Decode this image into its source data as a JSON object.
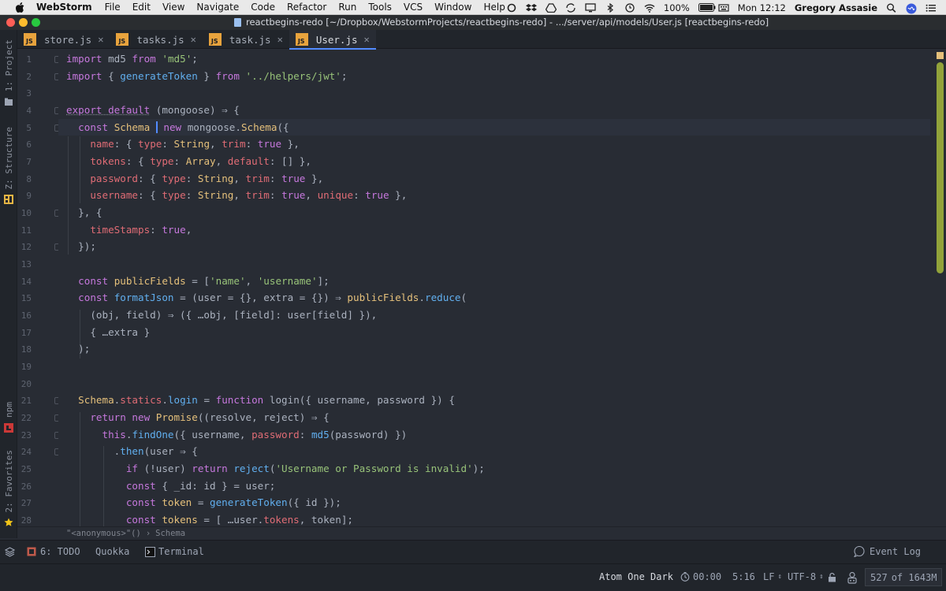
{
  "menubar": {
    "app_name": "WebStorm",
    "items": [
      "File",
      "Edit",
      "View",
      "Navigate",
      "Code",
      "Refactor",
      "Run",
      "Tools",
      "VCS",
      "Window",
      "Help"
    ],
    "battery": "100%",
    "clock": "Mon 12:12",
    "user": "Gregory Assasie"
  },
  "window": {
    "title": "reactbegins-redo [~/Dropbox/WebstormProjects/reactbegins-redo] - .../server/api/models/User.js [reactbegins-redo]"
  },
  "tabs": [
    {
      "label": "store.js",
      "active": false
    },
    {
      "label": "tasks.js",
      "active": false
    },
    {
      "label": "task.js",
      "active": false
    },
    {
      "label": "User.js",
      "active": true
    }
  ],
  "left_tools": {
    "project": "1: Project",
    "structure": "Z: Structure",
    "npm": "npm",
    "favorites": "2: Favorites"
  },
  "editor": {
    "line_numbers": [
      "1",
      "2",
      "3",
      "4",
      "5",
      "6",
      "7",
      "8",
      "9",
      "10",
      "11",
      "12",
      "13",
      "14",
      "15",
      "16",
      "17",
      "18",
      "19",
      "20",
      "21",
      "22",
      "23",
      "24",
      "25",
      "26",
      "27",
      "28"
    ],
    "current_line": "5"
  },
  "breadcrumb": {
    "scope": "\"<anonymous>\"()",
    "separator": "›",
    "symbol": "Schema"
  },
  "tool_windows": {
    "todo": "6: TODO",
    "quokka": "Quokka",
    "terminal": "Terminal",
    "event_log": "Event Log"
  },
  "status": {
    "theme": "Atom One Dark",
    "timer": "00:00",
    "position": "5:16",
    "line_sep": "LF",
    "encoding": "UTF-8",
    "memory_used": "527",
    "memory_total": "of 1643M"
  },
  "colors": {
    "keyword": "#c678dd",
    "string": "#98c379",
    "property": "#e06c75",
    "function": "#61afef",
    "class": "#e5c07b",
    "editor_bg": "#282c34"
  }
}
